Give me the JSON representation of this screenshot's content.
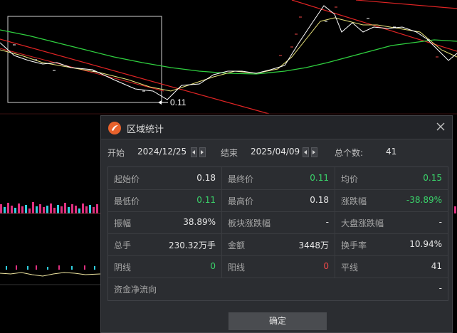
{
  "chart": {
    "marker_label": "0.11"
  },
  "dialog": {
    "title": "区域统计",
    "start_label": "开始",
    "start_date": "2024/12/25",
    "end_label": "结束",
    "end_date": "2025/04/09",
    "count_label": "总个数:",
    "count_value": "41",
    "stats": {
      "open_price_label": "起始价",
      "open_price": "0.18",
      "close_price_label": "最终价",
      "close_price": "0.11",
      "avg_price_label": "均价",
      "avg_price": "0.15",
      "low_price_label": "最低价",
      "low_price": "0.11",
      "high_price_label": "最高价",
      "high_price": "0.18",
      "change_label": "涨跌幅",
      "change": "-38.89%",
      "amplitude_label": "振幅",
      "amplitude": "38.89%",
      "sector_change_label": "板块涨跌幅",
      "sector_change": "-",
      "market_change_label": "大盘涨跌幅",
      "market_change": "-",
      "volume_label": "总手",
      "volume": "230.32万手",
      "amount_label": "金额",
      "amount": "3448万",
      "turnover_label": "换手率",
      "turnover": "10.94%",
      "down_days_label": "阴线",
      "down_days": "0",
      "up_days_label": "阳线",
      "up_days": "0",
      "flat_days_label": "平线",
      "flat_days": "41",
      "net_flow_label": "资金净流向",
      "net_flow": "-"
    },
    "ok_label": "确定",
    "colors": {
      "up": "#f04848",
      "down": "#3ad26a"
    }
  }
}
